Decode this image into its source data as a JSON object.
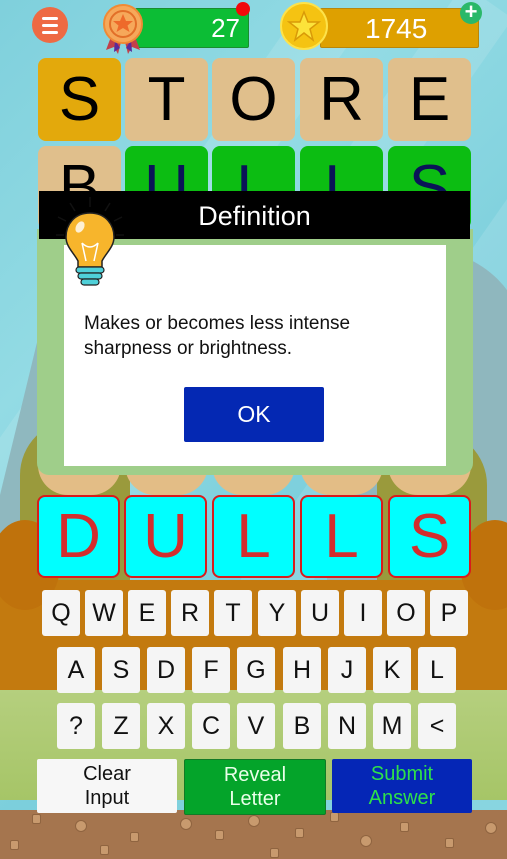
{
  "header": {
    "menu_icon": "hamburger-menu-icon",
    "level_value": "27",
    "level_badge_icon": "medal-icon",
    "coins_value": "1745",
    "coin_icon": "star-coin-icon",
    "add_coins_icon": "plus-icon"
  },
  "board": {
    "rows": [
      {
        "word": "STORE",
        "tiles": [
          {
            "letter": "S",
            "state": "gold"
          },
          {
            "letter": "T",
            "state": "beige"
          },
          {
            "letter": "O",
            "state": "beige"
          },
          {
            "letter": "R",
            "state": "beige"
          },
          {
            "letter": "E",
            "state": "beige"
          }
        ]
      },
      {
        "word": "BULLS",
        "tiles": [
          {
            "letter": "B",
            "state": "beige"
          },
          {
            "letter": "U",
            "state": "green"
          },
          {
            "letter": "L",
            "state": "green"
          },
          {
            "letter": "L",
            "state": "green"
          },
          {
            "letter": "S",
            "state": "green"
          }
        ]
      }
    ],
    "current_input": [
      "D",
      "U",
      "L",
      "L",
      "S"
    ]
  },
  "dialog": {
    "title": "Definition",
    "icon": "lightbulb-icon",
    "text_line1": "Makes or becomes less intense",
    "text_line2": "sharpness or brightness.",
    "ok_label": "OK"
  },
  "keyboard": {
    "row1": [
      "Q",
      "W",
      "E",
      "R",
      "T",
      "Y",
      "U",
      "I",
      "O",
      "P"
    ],
    "row2": [
      "A",
      "S",
      "D",
      "F",
      "G",
      "H",
      "J",
      "K",
      "L"
    ],
    "row3": [
      "?",
      "Z",
      "X",
      "C",
      "V",
      "B",
      "N",
      "M",
      "<"
    ]
  },
  "actions": {
    "clear_line1": "Clear",
    "clear_line2": "Input",
    "reveal_line1": "Reveal",
    "reveal_line2": "Letter",
    "submit_line1": "Submit",
    "submit_line2": "Answer"
  },
  "colors": {
    "correct": "#0cbd12",
    "present": "#e3a90c",
    "absent": "#e0bf8c",
    "input_tile": "#00ffff",
    "input_border": "#d81c1c"
  }
}
